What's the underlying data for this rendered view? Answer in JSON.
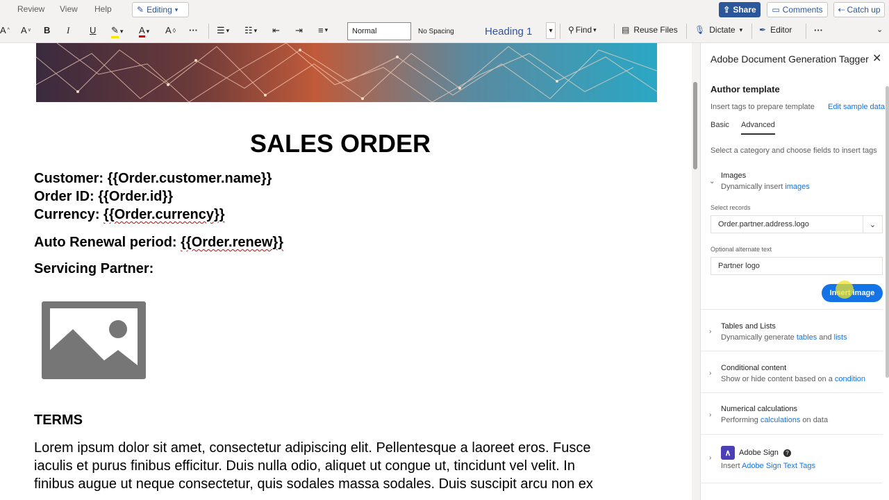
{
  "menu": {
    "review": "Review",
    "view": "View",
    "help": "Help",
    "editing": "Editing"
  },
  "actions": {
    "share": "Share",
    "comments": "Comments",
    "catch_up": "Catch up"
  },
  "ribbon": {
    "style_normal": "Normal",
    "style_no_spacing": "No Spacing",
    "style_heading1": "Heading 1",
    "find": "Find",
    "reuse_files": "Reuse Files",
    "dictate": "Dictate",
    "editor": "Editor"
  },
  "document": {
    "title": "SALES ORDER",
    "customer_label": "Customer: ",
    "customer_tag": "{{Order.customer.name}}",
    "order_label": "Order ID: ",
    "order_tag": "{{Order.id}}",
    "currency_label": "Currency: ",
    "currency_tag": "{{Order.currency}}",
    "renewal_label": "Auto Renewal period: ",
    "renewal_tag": "{{Order.renew}}",
    "partner_label": "Servicing Partner:",
    "terms_heading": "TERMS",
    "body_line1": "Lorem ipsum dolor sit amet, consectetur adipiscing elit. Pellentesque a laoreet eros. Fusce",
    "body_line2": "iaculis et purus finibus efficitur. Duis nulla odio, aliquet ut congue ut, tincidunt vel velit. In",
    "body_line3": "finibus augue ut neque consectetur, quis sodales massa sodales. Duis suscipit arcu non ex"
  },
  "pane": {
    "title": "Adobe Document Generation Tagger",
    "author_heading": "Author template",
    "insert_tags_text": "Insert tags to prepare template",
    "edit_sample_link": "Edit sample data",
    "tab_basic": "Basic",
    "tab_advanced": "Advanced",
    "select_category_text": "Select a category and choose fields to insert tags",
    "images": {
      "title": "Images",
      "sub_prefix": "Dynamically insert ",
      "sub_link": "images"
    },
    "select_records_label": "Select records",
    "select_records_value": "Order.partner.address.logo",
    "alt_text_label": "Optional alternate text",
    "alt_text_value": "Partner logo",
    "insert_image_button": "Insert image",
    "tables": {
      "title": "Tables and Lists",
      "sub_prefix": "Dynamically generate ",
      "link1": "tables",
      "and": " and ",
      "link2": "lists"
    },
    "conditional": {
      "title": "Conditional content",
      "sub_prefix": "Show or hide content based on a ",
      "link": "condition"
    },
    "numerical": {
      "title": "Numerical calculations",
      "sub_prefix": "Performing ",
      "link": "calculations",
      "sub_suffix": " on data"
    },
    "adobe_sign": {
      "title": "Adobe Sign",
      "sub_prefix": "Insert ",
      "link": "Adobe Sign Text Tags"
    }
  },
  "colors": {
    "accent": "#2b579a",
    "adobe_blue": "#1473e6"
  }
}
